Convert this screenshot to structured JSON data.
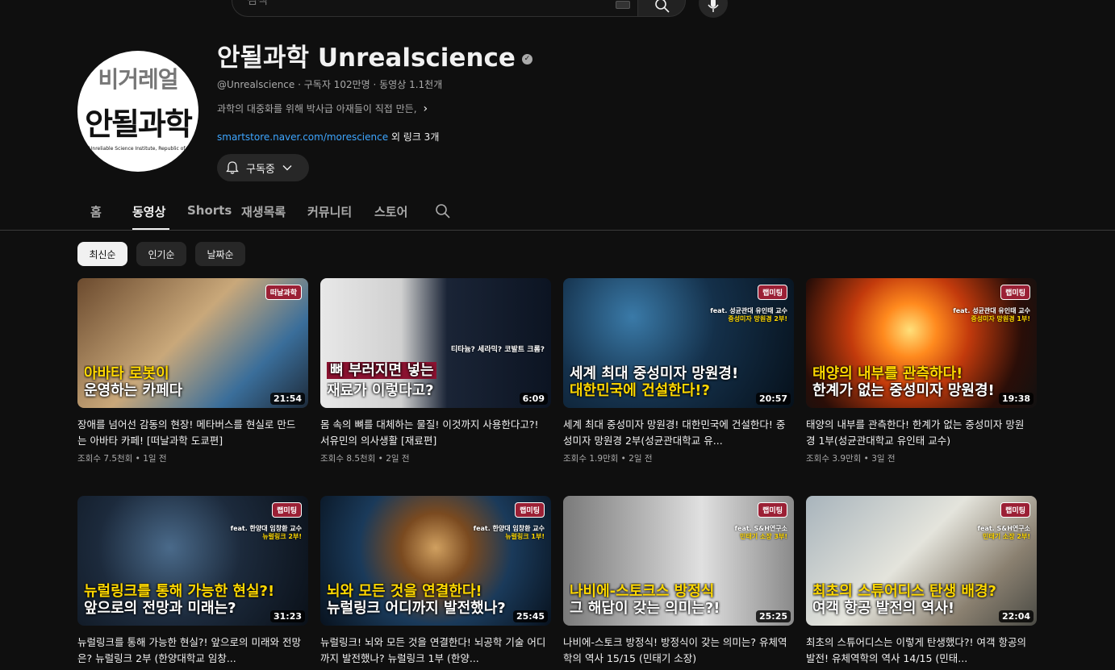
{
  "search": {
    "placeholder": "검색"
  },
  "channel": {
    "name": "안될과학 Unrealscience",
    "handle": "@Unrealscience",
    "subscribers": "구독자 102만명",
    "videos": "동영상 1.1천개",
    "description": "과학의 대중화를 위해 박사급 아재들이 직접 만든,",
    "link_url": "smartstore.naver.com/morescience",
    "link_more": "외 링크 3개",
    "subscribe_label": "구독중",
    "avatar_line1": "비거레얼",
    "avatar_line2": "안될과학",
    "avatar_line3": "Unreliable Science Institute, Republic of Korea"
  },
  "tabs": [
    {
      "label": "홈"
    },
    {
      "label": "동영상"
    },
    {
      "label": "Shorts"
    },
    {
      "label": "재생목록"
    },
    {
      "label": "커뮤니티"
    },
    {
      "label": "스토어"
    }
  ],
  "chips": [
    {
      "label": "최신순"
    },
    {
      "label": "인기순"
    },
    {
      "label": "날짜순"
    }
  ],
  "colors": {
    "accent_link": "#3ea6ff",
    "background": "#0f0f0f"
  },
  "videos": [
    {
      "title": "장애를 넘어선 감동의 현장! 메타버스를 현실로 만드는 아바타 카페! [떠날과학 도쿄편]",
      "views": "조회수 7.5천회",
      "age": "1일 전",
      "duration": "21:54",
      "thumb_line1": "아바타 로봇이",
      "thumb_line2": "운영하는 카페다",
      "badge": "떠날과학",
      "feat": "",
      "feat_sub": ""
    },
    {
      "title": "몸 속의 뼈를 대체하는 물질! 이것까지 사용한다고?! 서유민의 의사생활 [재료편]",
      "views": "조회수 8.5천회",
      "age": "2일 전",
      "duration": "6:09",
      "thumb_line1": "뼈 부러지면 넣는",
      "thumb_line2": "재료가 이렇다고?",
      "badge": "",
      "feat": "티타늄? 세라믹? 코발트 크롬?",
      "feat_sub": ""
    },
    {
      "title": "세계 최대 중성미자 망원경! 대한민국에 건설한다! 중성미자 망원경 2부(성균관대학교 유...",
      "views": "조회수 1.9만회",
      "age": "2일 전",
      "duration": "20:57",
      "thumb_line1": "세계 최대 중성미자 망원경!",
      "thumb_line2": "대한민국에 건설한다!?",
      "badge": "랩미팅",
      "feat": "feat. 성균관대 유인태 교수",
      "feat_sub": "중성미자 망원경 2부!"
    },
    {
      "title": "태양의 내부를 관측한다! 한계가 없는 중성미자 망원경 1부(성균관대학교 유인태 교수)",
      "views": "조회수 3.9만회",
      "age": "3일 전",
      "duration": "19:38",
      "thumb_line1": "태양의 내부를 관측하다!",
      "thumb_line2": "한계가 없는 중성미자 망원경!",
      "badge": "랩미팅",
      "feat": "feat. 성균관대 유인태 교수",
      "feat_sub": "중성미자 망원경 1부!"
    },
    {
      "title": "뉴럴링크를 통해 가능한 현실?! 앞으로의 미래와 전망은? 뉴럴링크 2부 (한양대학교 임창...",
      "views": "",
      "age": "",
      "duration": "31:23",
      "thumb_line1": "뉴럴링크를 통해 가능한 현실?!",
      "thumb_line2": "앞으로의 전망과 미래는?",
      "badge": "랩미팅",
      "feat": "feat. 한양대 임창환 교수",
      "feat_sub": "뉴럴링크 2부!"
    },
    {
      "title": "뉴럴링크! 뇌와 모든 것을 연결한다! 뇌공학 기술 어디까지 발전했나? 뉴럴링크 1부 (한양...",
      "views": "",
      "age": "",
      "duration": "25:45",
      "thumb_line1": "뇌와 모든 것을 연결한다!",
      "thumb_line2": "뉴럴링크 어디까지 발전했나?",
      "badge": "랩미팅",
      "feat": "feat. 한양대 임창환 교수",
      "feat_sub": "뉴럴링크 1부!"
    },
    {
      "title": "나비에-스토크 방정식! 방정식이 갖는 의미는? 유체역학의 역사 15/15 (민태기 소장)",
      "views": "",
      "age": "",
      "duration": "25:25",
      "thumb_line1": "나비에-스토크스 방정식",
      "thumb_line2": "그 해답이 갖는 의미는?!",
      "badge": "랩미팅",
      "feat": "feat. S&H연구소",
      "feat_sub": "민태기 소장 3부!"
    },
    {
      "title": "최초의 스튜어디스는 이렇게 탄생했다?! 여객 항공의 발전! 유체역학의 역사 14/15 (민태...",
      "views": "",
      "age": "",
      "duration": "22:04",
      "thumb_line1": "최초의 스튜어디스 탄생 배경?",
      "thumb_line2": "여객 항공 발전의 역사!",
      "badge": "랩미팅",
      "feat": "feat. S&H연구소",
      "feat_sub": "민태기 소장 2부!"
    }
  ]
}
